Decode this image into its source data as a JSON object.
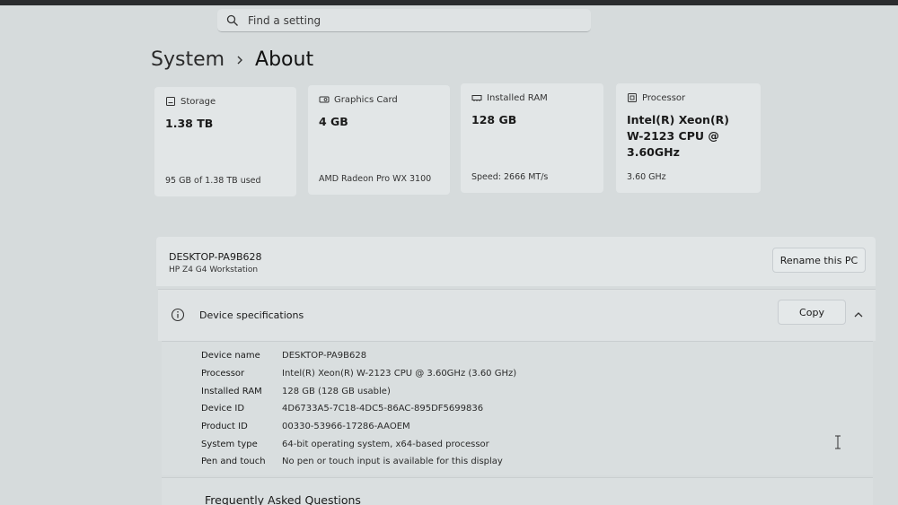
{
  "search": {
    "placeholder": "Find a setting"
  },
  "breadcrumb": {
    "parent": "System",
    "current": "About"
  },
  "cards": {
    "storage": {
      "label": "Storage",
      "value": "1.38 TB",
      "sub": "95 GB of 1.38 TB used"
    },
    "graphics": {
      "label": "Graphics Card",
      "value": "4 GB",
      "sub": "AMD Radeon Pro WX 3100"
    },
    "ram": {
      "label": "Installed RAM",
      "value": "128 GB",
      "sub": "Speed: 2666 MT/s"
    },
    "processor": {
      "label": "Processor",
      "value_lines": [
        "Intel(R) Xeon(R)",
        "W-2123 CPU @",
        "3.60GHz"
      ],
      "sub": "3.60 GHz"
    }
  },
  "pc": {
    "name": "DESKTOP-PA9B628",
    "model": "HP Z4 G4 Workstation",
    "rename_label": "Rename this PC"
  },
  "specs": {
    "title": "Device specifications",
    "copy_label": "Copy",
    "rows": [
      {
        "key": "Device name",
        "value": "DESKTOP-PA9B628"
      },
      {
        "key": "Processor",
        "value": "Intel(R) Xeon(R) W-2123 CPU @ 3.60GHz (3.60 GHz)"
      },
      {
        "key": "Installed RAM",
        "value": "128 GB (128 GB usable)"
      },
      {
        "key": "Device ID",
        "value": "4D6733A5-7C18-4DC5-86AC-895DF5699836"
      },
      {
        "key": "Product ID",
        "value": "00330-53966-17286-AAOEM"
      },
      {
        "key": "System type",
        "value": "64-bit operating system, x64-based processor"
      },
      {
        "key": "Pen and touch",
        "value": "No pen or touch input is available for this display"
      }
    ]
  },
  "faq": {
    "title": "Frequently Asked Questions"
  },
  "colors": {
    "background": "#d6dbdc",
    "card": "#e2e6e7",
    "text": "#1a1a1a"
  }
}
